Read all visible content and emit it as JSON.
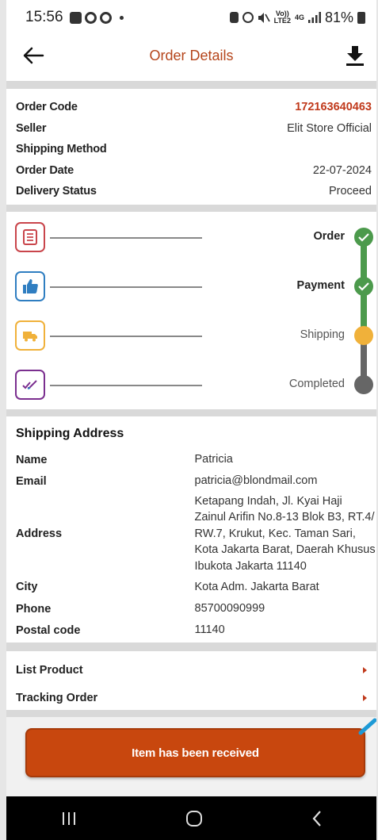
{
  "status_bar": {
    "time": "15:56",
    "network_top": "Vo))",
    "network_bottom": "LTE2",
    "network_gen": "4G",
    "battery": "81%"
  },
  "header": {
    "title": "Order Details"
  },
  "order_info": [
    {
      "label": "Order Code",
      "value": "172163640463"
    },
    {
      "label": "Seller",
      "value": "Elit Store Official"
    },
    {
      "label": "Shipping Method",
      "value": ""
    },
    {
      "label": "Order Date",
      "value": "22-07-2024"
    },
    {
      "label": "Delivery Status",
      "value": "Proceed"
    }
  ],
  "timeline": [
    {
      "label": "Order",
      "state": "done",
      "icon": "receipt-icon",
      "color": "#c9454b"
    },
    {
      "label": "Payment",
      "state": "done",
      "icon": "thumbs-up-icon",
      "color": "#2f7ec1"
    },
    {
      "label": "Shipping",
      "state": "current",
      "icon": "truck-icon",
      "color": "#f0b13a"
    },
    {
      "label": "Completed",
      "state": "pending",
      "icon": "double-check-icon",
      "color": "#7b2f8f"
    }
  ],
  "shipping_address": {
    "heading": "Shipping Address",
    "name_label": "Name",
    "name": "Patricia",
    "email_label": "Email",
    "email": "patricia@blondmail.com",
    "address_label": "Address",
    "address_lines": [
      "Ketapang Indah, Jl. Kyai Haji",
      "Zainul Arifin No.8-13 Blok B3, RT.4/",
      "RW.7, Krukut, Kec. Taman Sari,",
      "Kota Jakarta Barat, Daerah Khusus",
      "Ibukota Jakarta 11140"
    ],
    "city_label": "City",
    "city": "Kota Adm. Jakarta Barat",
    "phone_label": "Phone",
    "phone": "85700090999",
    "postal_label": "Postal code",
    "postal": "11140"
  },
  "links": {
    "list_product": "List Product",
    "tracking_order": "Tracking Order"
  },
  "action": {
    "received_label": "Item has been received"
  },
  "colors": {
    "accent": "#c8470e",
    "title": "#b5451b",
    "done": "#4c9a4c",
    "current": "#f0b13a",
    "pending": "#666666"
  }
}
